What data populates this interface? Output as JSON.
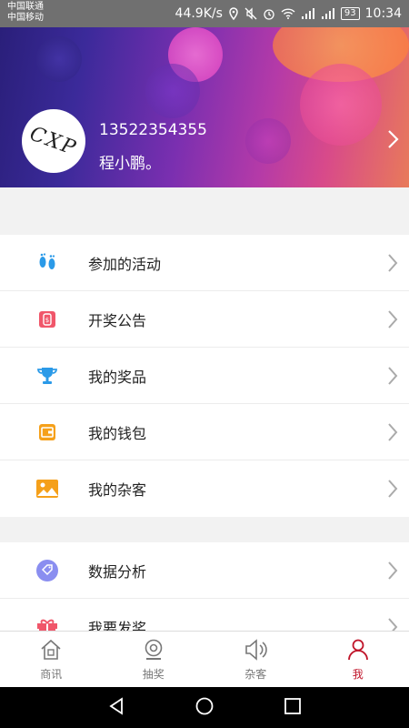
{
  "status_bar": {
    "carrier1": "中国联通",
    "carrier2": "中国移动",
    "speed": "44.9K/s",
    "battery": "93",
    "time": "10:34"
  },
  "profile": {
    "avatar_text": "CXP",
    "phone": "13522354355",
    "nickname": "程小鹏。"
  },
  "menu_group1": [
    {
      "label": "参加的活动",
      "icon": "footprints-icon",
      "color": "#2b9ae8"
    },
    {
      "label": "开奖公告",
      "icon": "money-bag-icon",
      "color": "#f0566a"
    },
    {
      "label": "我的奖品",
      "icon": "trophy-icon",
      "color": "#2b9ae8"
    },
    {
      "label": "我的钱包",
      "icon": "wallet-icon",
      "color": "#f5a01a"
    },
    {
      "label": "我的杂客",
      "icon": "image-icon",
      "color": "#f5a01a"
    }
  ],
  "menu_group2": [
    {
      "label": "数据分析",
      "icon": "tag-icon",
      "color": "#8a8ef0"
    },
    {
      "label": "我要发奖",
      "icon": "gift-icon",
      "color": "#f0566a"
    }
  ],
  "bottom_nav": [
    {
      "label": "商讯",
      "icon": "house-icon"
    },
    {
      "label": "抽奖",
      "icon": "camera-icon"
    },
    {
      "label": "杂客",
      "icon": "speaker-icon"
    },
    {
      "label": "我",
      "icon": "person-icon",
      "active": true
    }
  ],
  "colors": {
    "active": "#c0152a",
    "inactive": "#777777"
  }
}
